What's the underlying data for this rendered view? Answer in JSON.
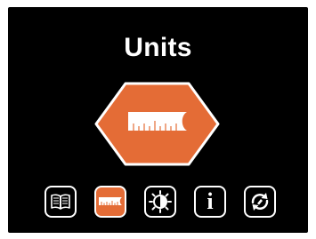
{
  "screen": {
    "title": "Units"
  },
  "colors": {
    "accent": "#e46c36",
    "background": "#000000",
    "foreground": "#ffffff"
  },
  "hero_icon": "ruler-icon",
  "tabs": [
    {
      "name": "manual",
      "icon": "book-icon",
      "active": false
    },
    {
      "name": "units",
      "icon": "ruler-icon",
      "active": true
    },
    {
      "name": "contrast",
      "icon": "brightness-icon",
      "active": false
    },
    {
      "name": "info",
      "icon": "info-icon",
      "glyph": "i",
      "active": false
    },
    {
      "name": "reset",
      "icon": "refresh-icon",
      "active": false
    }
  ]
}
